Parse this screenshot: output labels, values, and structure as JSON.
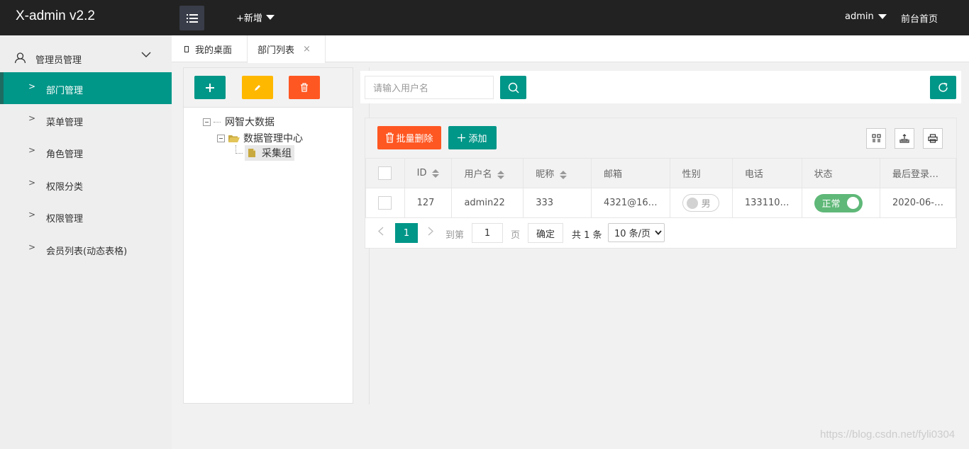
{
  "header": {
    "logo": "X-admin v2.2",
    "add_label": "+新增",
    "user": "admin",
    "front_page": "前台首页"
  },
  "sidebar": {
    "group_label": "管理员管理",
    "items": [
      {
        "label": "部门管理",
        "active": true
      },
      {
        "label": "菜单管理"
      },
      {
        "label": "角色管理"
      },
      {
        "label": "权限分类"
      },
      {
        "label": "权限管理"
      },
      {
        "label": "会员列表(动态表格)"
      }
    ],
    "item_marker": ">"
  },
  "tabs": [
    {
      "label": "我的桌面"
    },
    {
      "label": "部门列表",
      "close": "×"
    }
  ],
  "tree": {
    "nodes": [
      {
        "label": "网智大数据"
      },
      {
        "label": "数据管理中心"
      },
      {
        "label": "采集组"
      }
    ]
  },
  "search": {
    "placeholder": "请输入用户名"
  },
  "table": {
    "toolbar": {
      "batch_delete": "批量删除",
      "add": "添加"
    },
    "columns": [
      "ID",
      "用户名",
      "昵称",
      "邮箱",
      "性别",
      "电话",
      "状态",
      "最后登录…"
    ],
    "rows": [
      {
        "id": "127",
        "username": "admin22",
        "nickname": "333",
        "email": "4321@16…",
        "gender": "男",
        "phone": "133110…",
        "status": "正常",
        "last_login": "2020-06-…"
      }
    ]
  },
  "pager": {
    "current": "1",
    "goto_label": "到第",
    "goto_value": "1",
    "page_label": "页",
    "confirm": "确定",
    "total": "共 1 条",
    "page_size": "10 条/页"
  },
  "watermark": "https://blog.csdn.net/fyli0304",
  "colors": {
    "primary": "#009688",
    "warm": "#ffb800",
    "danger": "#ff5722",
    "header_bg": "#222222",
    "switch_on": "#5fb878"
  }
}
